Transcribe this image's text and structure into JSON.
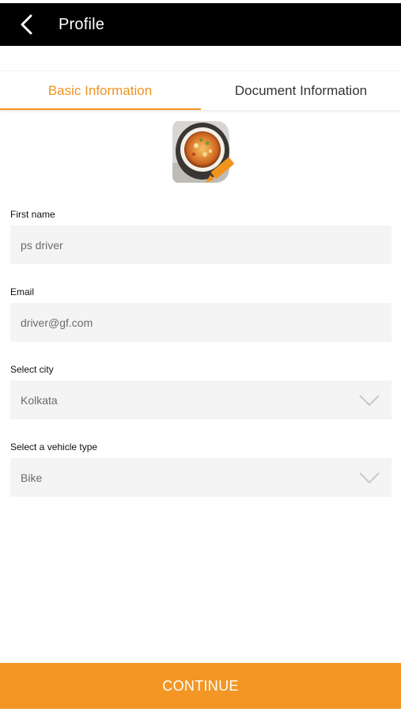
{
  "header": {
    "title": "Profile",
    "back_icon": "chevron-left-icon"
  },
  "tabs": [
    {
      "label": "Basic Information",
      "active": true
    },
    {
      "label": "Document Information",
      "active": false
    }
  ],
  "avatar": {
    "image": "food-bowl-photo",
    "edit_icon": "pencil-icon"
  },
  "form": {
    "first_name": {
      "label": "First name",
      "value": "ps driver"
    },
    "email": {
      "label": "Email",
      "value": "driver@gf.com"
    },
    "city": {
      "label": "Select city",
      "value": "Kolkata",
      "icon": "chevron-down-icon"
    },
    "vehicle": {
      "label": "Select a vehicle type",
      "value": "Bike",
      "icon": "chevron-down-icon"
    }
  },
  "footer": {
    "continue_label": "CONTINUE"
  },
  "colors": {
    "accent": "#f39623",
    "header_bg": "#000000",
    "field_bg": "#f4f4f4"
  }
}
